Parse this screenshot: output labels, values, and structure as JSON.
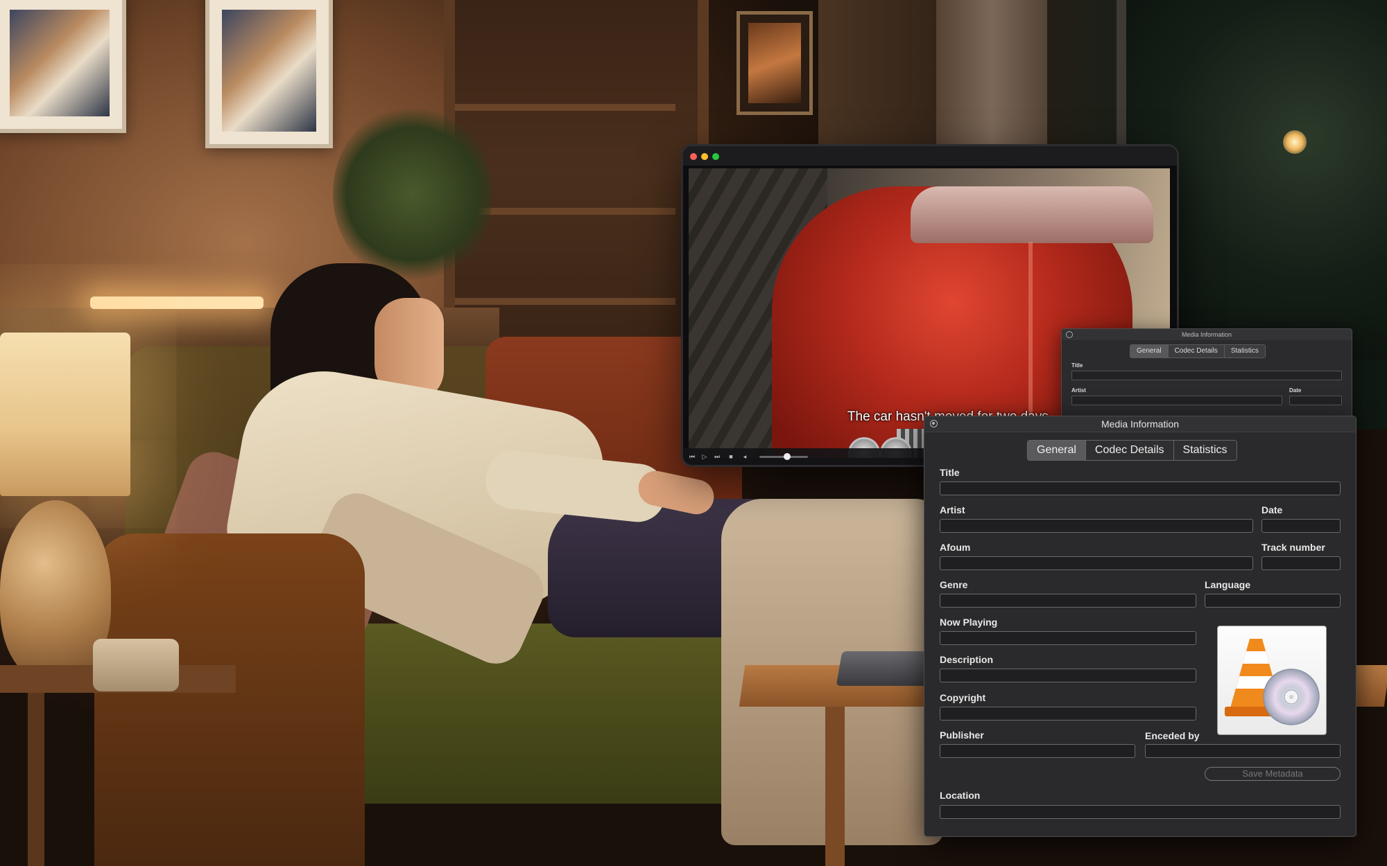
{
  "player": {
    "subtitle": "The car hasn't moved for two days.",
    "controls": {
      "rewind": "⏮",
      "play": "▷",
      "forward": "⏭",
      "stop": "■",
      "volume": "◂"
    },
    "playback_fraction": 0.57
  },
  "mini_panel": {
    "title": "Media Information",
    "tabs": [
      "General",
      "Codec Details",
      "Statistics"
    ],
    "labels": {
      "title": "Title",
      "artist": "Artist",
      "date": "Date"
    }
  },
  "panel": {
    "title": "Media Information",
    "tabs": [
      {
        "label": "General",
        "active": true
      },
      {
        "label": "Codec Details",
        "active": false
      },
      {
        "label": "Statistics",
        "active": false
      }
    ],
    "fields": {
      "title": {
        "label": "Title",
        "value": ""
      },
      "artist": {
        "label": "Artist",
        "value": ""
      },
      "date": {
        "label": "Date",
        "value": ""
      },
      "album": {
        "label": "Afoum",
        "value": ""
      },
      "track_number": {
        "label": "Track number",
        "value": ""
      },
      "genre": {
        "label": "Genre",
        "value": ""
      },
      "language": {
        "label": "Language",
        "value": ""
      },
      "now_playing": {
        "label": "Now Playing",
        "value": ""
      },
      "description": {
        "label": "Description",
        "value": ""
      },
      "copyright": {
        "label": "Copyright",
        "value": ""
      },
      "publisher": {
        "label": "Publisher",
        "value": ""
      },
      "encoded_by": {
        "label": "Enceded by",
        "value": ""
      },
      "location": {
        "label": "Location",
        "value": ""
      }
    },
    "save_button": "Save Metadata",
    "artwork_icon": "vlc-cone-icon"
  },
  "colors": {
    "panel_bg": "#2a2a2c",
    "field_bg": "#1f1f21",
    "tab_active": "#5a5a5c",
    "cone_orange": "#f08a1c"
  }
}
